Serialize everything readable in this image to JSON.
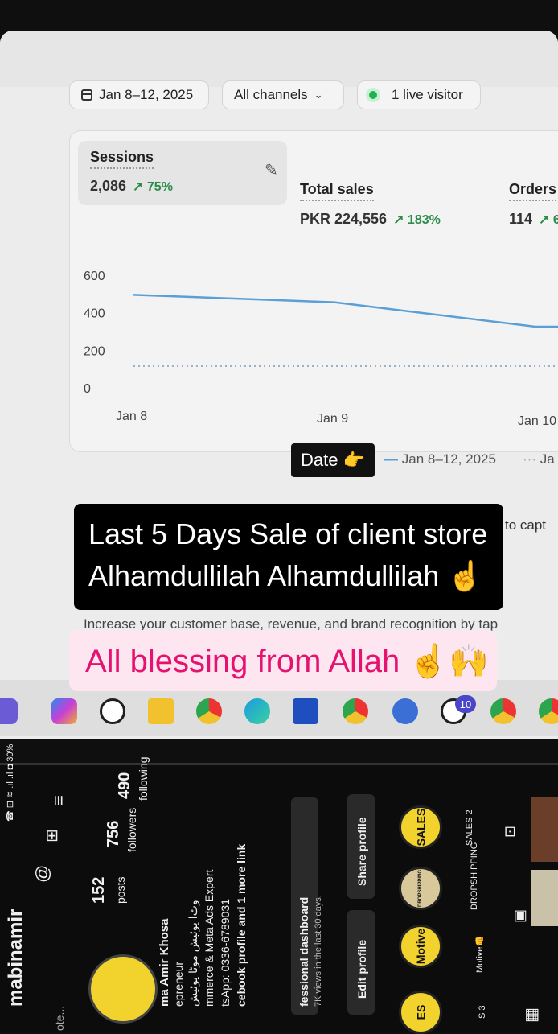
{
  "toolbar": {
    "date_range": "Jan 8–12, 2025",
    "channels": "All channels",
    "live_visitors": "1 live visitor"
  },
  "metrics": [
    {
      "label": "Sessions",
      "value": "2,086",
      "change": "↗ 75%"
    },
    {
      "label": "Total sales",
      "value": "PKR 224,556",
      "change": "↗ 183%"
    },
    {
      "label": "Orders",
      "value": "114",
      "change": "↗ 6"
    }
  ],
  "chart_data": {
    "type": "line",
    "y_ticks": [
      "600",
      "400",
      "200",
      "0"
    ],
    "x_ticks": [
      "Jan 8",
      "Jan 9",
      "Jan 10"
    ],
    "ylim": [
      0,
      600
    ],
    "series": [
      {
        "name": "Jan 8–12, 2025",
        "x": [
          "Jan 8",
          "Jan 9",
          "Jan 10"
        ],
        "values": [
          500,
          460,
          330
        ],
        "color": "#5a9fd6",
        "style": "solid"
      },
      {
        "name": "Ja",
        "x": [
          "Jan 8",
          "Jan 9",
          "Jan 10"
        ],
        "values": [
          120,
          120,
          120
        ],
        "color": "#9ab0c4",
        "style": "dotted"
      }
    ],
    "legend": {
      "current": "Jan 8–12, 2025",
      "previous": "Ja"
    }
  },
  "overlay": {
    "date_tag": "Date 👉",
    "caption_line1": "Last 5 Days Sale of client store",
    "caption_line2": "Alhamdullilah  Alhamdullilah ☝️",
    "caption_pink": "All blessing from Allah ☝️🙌"
  },
  "background_text": {
    "right_snippet": "to capt",
    "description": "Increase your customer base, revenue, and brand recognition by tap"
  },
  "taskbar": {
    "whatsapp_badge": "10"
  },
  "phone": {
    "status": "☎ ⊡ ≋ .ıl .ıl ◘ 30%",
    "username": "mabinamir",
    "name": "ma Amir Khosa",
    "role": "epreneur",
    "bio_urdu": "وٹ‌ا یوئیش موٹا یوئیش",
    "bio_expert": "mmerce & Meta Ads Expert",
    "bio_whatsapp": "tsApp: 0336-6789031",
    "bio_link": "cebook profile and 1 more link",
    "posts_count": "152",
    "posts_label": "posts",
    "followers_count": "756",
    "followers_label": "followers",
    "following_count": "490",
    "following_label": "following",
    "dashboard_title": "fessional dashboard",
    "dashboard_sub": "7K views in the last 30 days.",
    "edit_profile": "Edit profile",
    "share_profile": "Share profile",
    "highlights": [
      "SALES",
      "DROPSHIPPING",
      "Motive",
      "ES"
    ],
    "highlight_labels": [
      "SALES 2",
      "DROPSHIPPING",
      "Motive👊",
      "S 3"
    ],
    "note": "ote..."
  }
}
